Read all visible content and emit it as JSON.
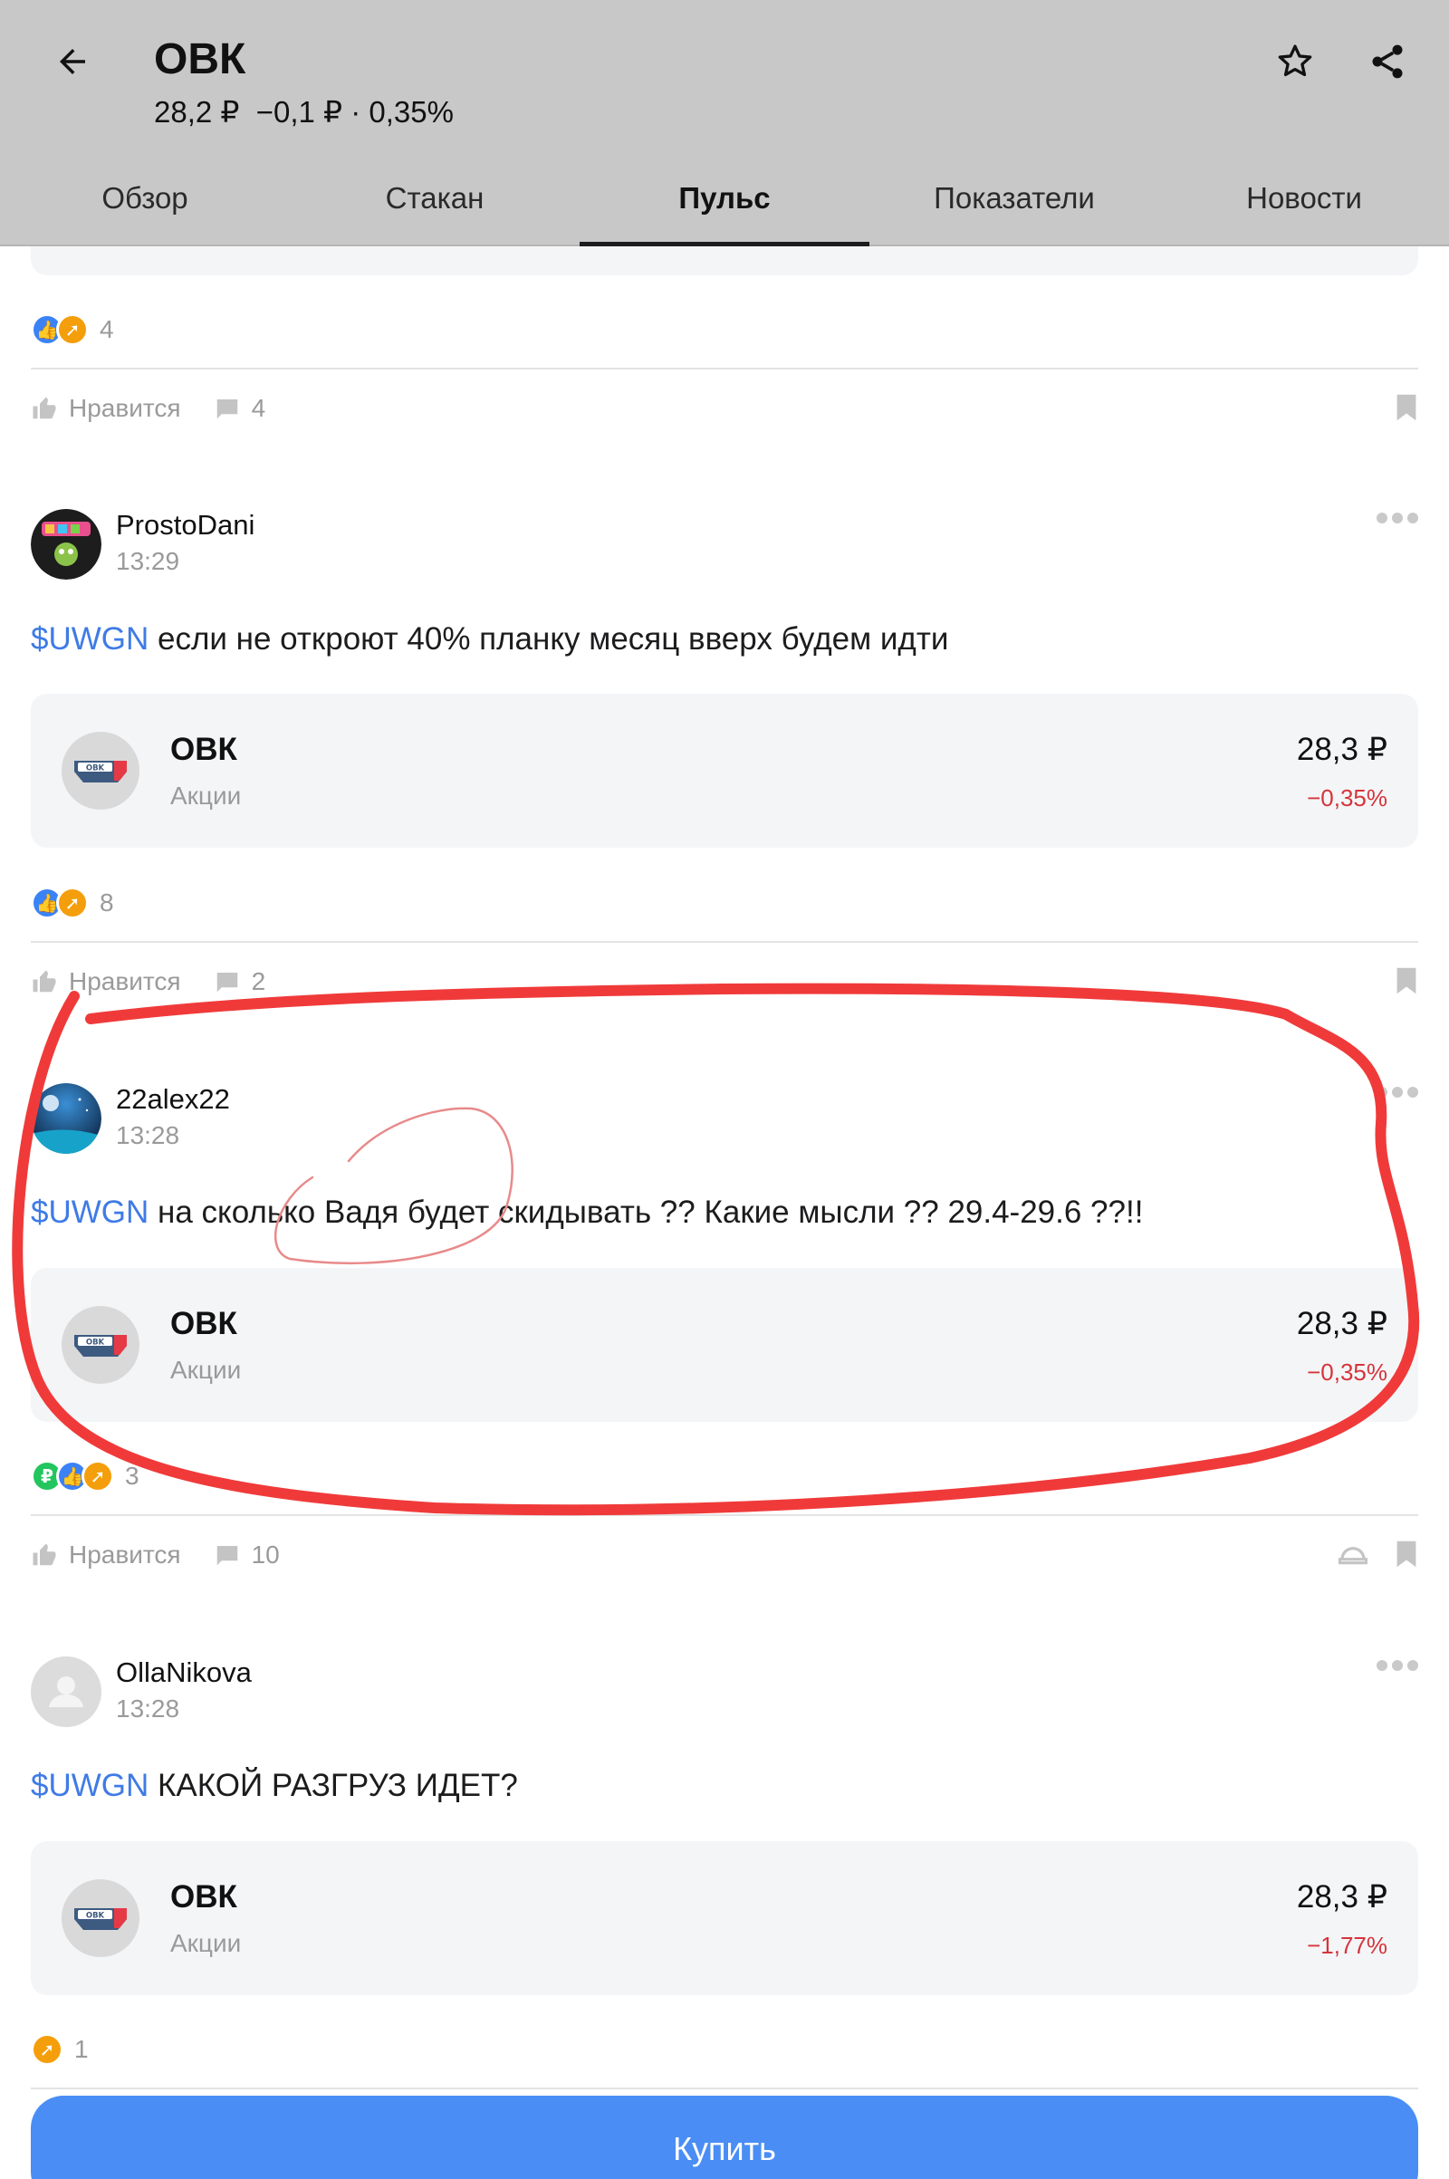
{
  "header": {
    "title": "ОВК",
    "subtitle": "28,2 ₽  −0,1 ₽ · 0,35%",
    "tabs": [
      "Обзор",
      "Стакан",
      "Пульс",
      "Показатели",
      "Новости"
    ],
    "active_tab": "Пульс"
  },
  "icons": [
    "back-arrow-icon",
    "star-icon",
    "share-icon",
    "like-icon",
    "comment-icon",
    "bookmark-icon",
    "repost-icon",
    "more-icon"
  ],
  "colors": {
    "header_bg": "#c8c8c8",
    "ticker": "#3f7be6",
    "negative": "#d6343b",
    "buy_button": "#4a8ef5",
    "annotation": "#f03a3a"
  },
  "top_post": {
    "reaction_count": "4",
    "like_label": "Нравится",
    "comment_count": "4"
  },
  "posts": [
    {
      "author": "ProstoDani",
      "time": "13:29",
      "ticker": "$UWGN",
      "text": " если не откроют 40% планку месяц вверх будем идти",
      "stock": {
        "name": "ОВК",
        "type": "Акции",
        "price": "28,3 ₽",
        "change": "−0,35%",
        "logo_text": "OBK"
      },
      "reaction_count": "8",
      "like_label": "Нравится",
      "comment_count": "2"
    },
    {
      "author": "22alex22",
      "time": "13:28",
      "ticker": "$UWGN",
      "text": " на сколько Вадя будет скидывать ?? Какие мысли ?? 29.4-29.6 ??!!",
      "stock": {
        "name": "ОВК",
        "type": "Акции",
        "price": "28,3 ₽",
        "change": "−0,35%",
        "logo_text": "OBK"
      },
      "reaction_count": "3",
      "like_label": "Нравится",
      "comment_count": "10"
    },
    {
      "author": "OllaNikova",
      "time": "13:28",
      "ticker": "$UWGN",
      "text": " КАКОЙ РАЗГРУЗ ИДЕТ?",
      "stock": {
        "name": "ОВК",
        "type": "Акции",
        "price": "28,3 ₽",
        "change": "−1,77%",
        "logo_text": "OBK"
      },
      "reaction_count": "1"
    }
  ],
  "buy_label": "Купить"
}
